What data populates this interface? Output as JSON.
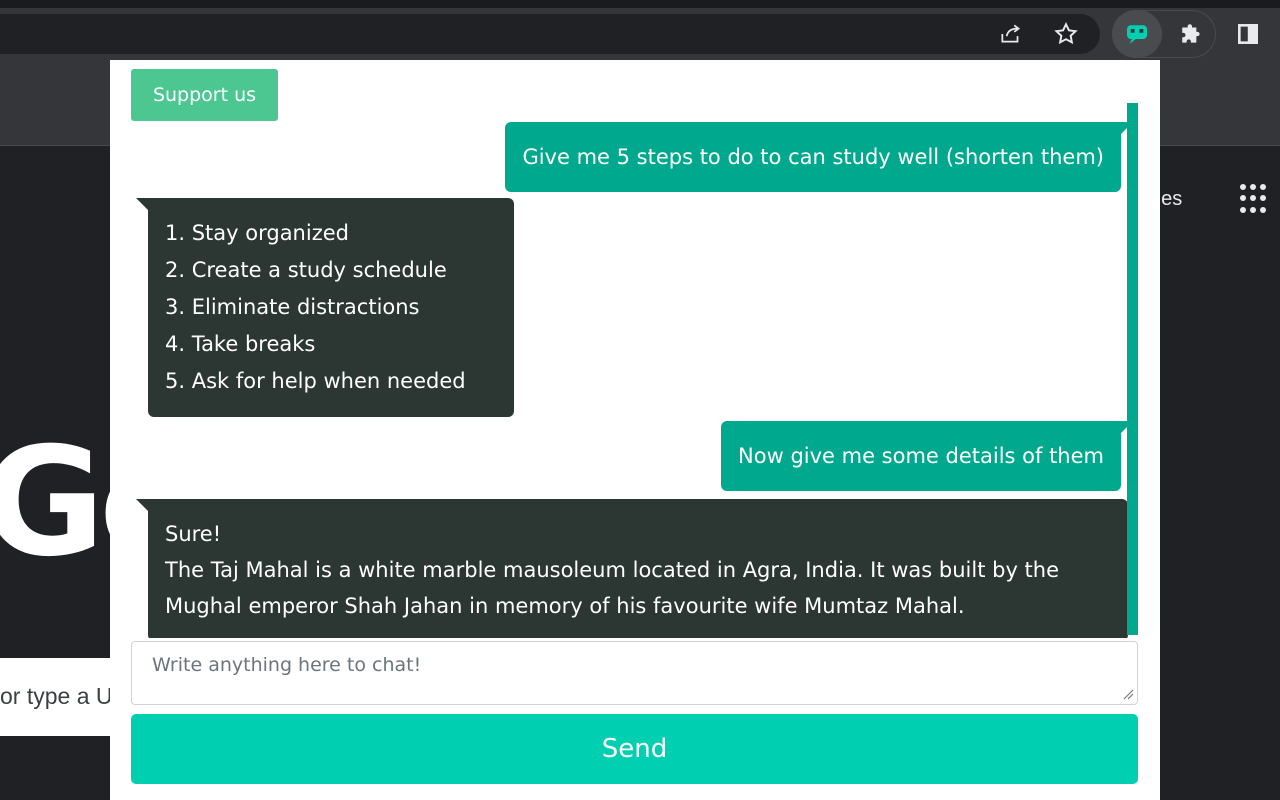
{
  "browser": {
    "icons": [
      "share-icon",
      "star-icon",
      "extension-chatbot-icon",
      "puzzle-icon",
      "side-panel-icon"
    ]
  },
  "background_page": {
    "logo_text": "Go",
    "images_link": "ges",
    "search_placeholder": "or type a U"
  },
  "popup": {
    "support_label": "Support us",
    "messages": [
      {
        "role": "user",
        "text": "Give me 5 steps to do to can study well (shorten them)"
      },
      {
        "role": "bot",
        "text": "1. Stay organized\n2. Create a study schedule\n3. Eliminate distractions\n4. Take breaks\n5. Ask for help when needed"
      },
      {
        "role": "user",
        "text": "Now give me some details of them"
      },
      {
        "role": "bot",
        "text": "Sure!\nThe Taj Mahal is a white marble mausoleum located in Agra, India. It was built by the Mughal emperor Shah Jahan in memory of his favourite wife Mumtaz Mahal."
      }
    ],
    "input_placeholder": "Write anything here to chat!",
    "send_label": "Send"
  },
  "colors": {
    "user_bubble": "#00a98e",
    "bot_bubble": "#2c3632",
    "send_button": "#00cfb1",
    "support_button": "#4cc792"
  }
}
